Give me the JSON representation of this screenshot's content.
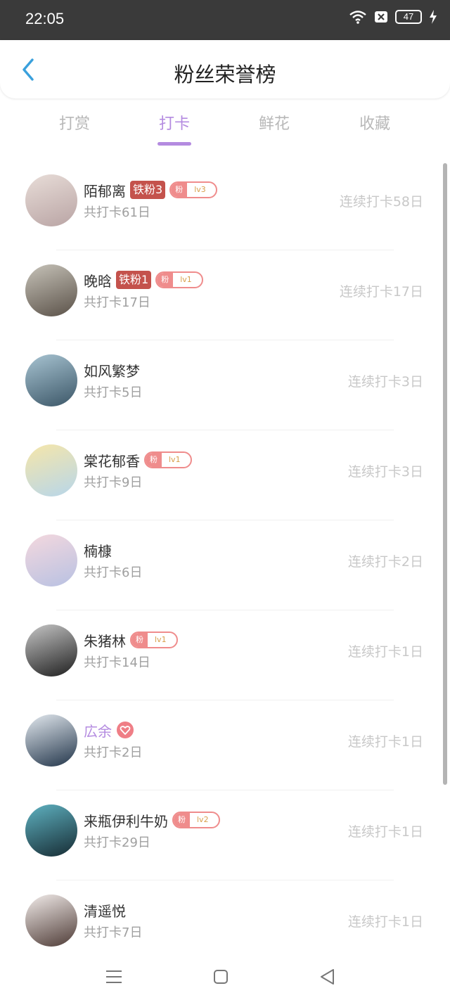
{
  "status": {
    "time": "22:05",
    "battery": "47"
  },
  "header": {
    "title": "粉丝荣誉榜"
  },
  "tabs": [
    {
      "label": "打赏"
    },
    {
      "label": "打卡"
    },
    {
      "label": "鲜花"
    },
    {
      "label": "收藏"
    }
  ],
  "active_tab": "打卡",
  "rows": [
    {
      "name": "陌郁离",
      "tie": "铁粉3",
      "fan": "粉",
      "lv": "lv3",
      "total": "共打卡61日",
      "streak": "连续打卡58日",
      "avatar_colors": [
        "#e8ddd8",
        "#b9a4a4"
      ]
    },
    {
      "name": "晚晗",
      "tie": "铁粉1",
      "fan": "粉",
      "lv": "lv1",
      "total": "共打卡17日",
      "streak": "连续打卡17日",
      "avatar_colors": [
        "#c7c3b9",
        "#5a5148"
      ]
    },
    {
      "name": "如风繁梦",
      "total": "共打卡5日",
      "streak": "连续打卡3日",
      "avatar_colors": [
        "#a8c4d2",
        "#3b5667"
      ]
    },
    {
      "name": "棠花郁香",
      "fan": "粉",
      "lv": "lv1",
      "total": "共打卡9日",
      "streak": "连续打卡3日",
      "avatar_colors": [
        "#f6e6a9",
        "#b7d6ea"
      ]
    },
    {
      "name": "楠槺",
      "total": "共打卡6日",
      "streak": "连续打卡2日",
      "avatar_colors": [
        "#f4d8de",
        "#b8c1e2"
      ]
    },
    {
      "name": "朱猪林",
      "fan": "粉",
      "lv": "lv1",
      "total": "共打卡14日",
      "streak": "连续打卡1日",
      "avatar_colors": [
        "#c6c6c6",
        "#1f1f1f"
      ]
    },
    {
      "name": "広余",
      "heart": true,
      "total": "共打卡2日",
      "streak": "连续打卡1日",
      "avatar_colors": [
        "#e3e9ef",
        "#22354a"
      ]
    },
    {
      "name": "来瓶伊利牛奶",
      "fan": "粉",
      "lv": "lv2",
      "total": "共打卡29日",
      "streak": "连续打卡1日",
      "avatar_colors": [
        "#5fb2c1",
        "#162b33"
      ]
    },
    {
      "name": "清遥悦",
      "total": "共打卡7日",
      "streak": "连续打卡1日",
      "avatar_colors": [
        "#f2ecea",
        "#4e3b36"
      ]
    }
  ]
}
